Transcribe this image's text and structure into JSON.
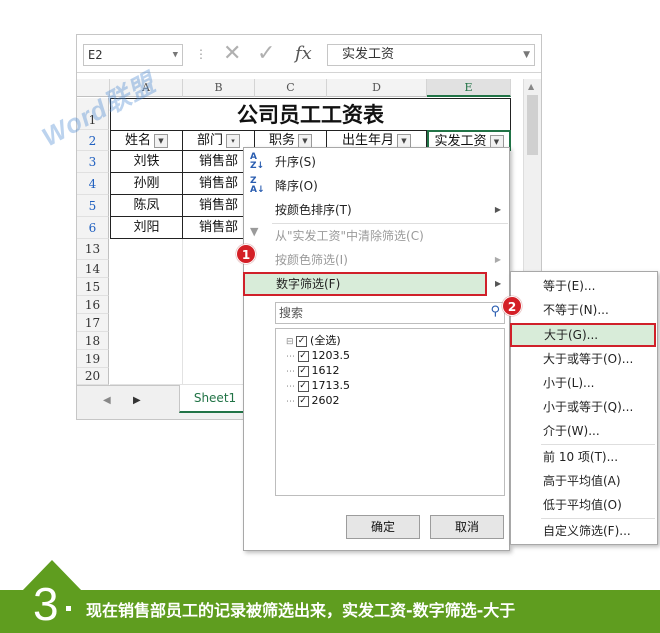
{
  "formula_bar": {
    "name_box": "E2",
    "formula": "实发工资"
  },
  "columns": [
    "A",
    "B",
    "C",
    "D",
    "E"
  ],
  "selected_column": "E",
  "rows": [
    {
      "num": "1",
      "cells": []
    },
    {
      "num": "2",
      "cells": [
        "姓名",
        "部门",
        "职务",
        "出生年月",
        "实发工资"
      ]
    },
    {
      "num": "3",
      "cells": [
        "刘铁",
        "销售部"
      ]
    },
    {
      "num": "4",
      "cells": [
        "孙刚",
        "销售部"
      ]
    },
    {
      "num": "5",
      "cells": [
        "陈凤",
        "销售部"
      ]
    },
    {
      "num": "6",
      "cells": [
        "刘阳",
        "销售部"
      ]
    },
    {
      "num": "13",
      "cells": []
    },
    {
      "num": "14",
      "cells": []
    },
    {
      "num": "15",
      "cells": []
    },
    {
      "num": "16",
      "cells": []
    },
    {
      "num": "17",
      "cells": []
    },
    {
      "num": "18",
      "cells": []
    },
    {
      "num": "19",
      "cells": []
    },
    {
      "num": "20",
      "cells": []
    }
  ],
  "table_title": "公司员工工资表",
  "sheet_tab": "Sheet1",
  "filter_menu": {
    "sort_asc": "升序(S)",
    "sort_desc": "降序(O)",
    "sort_by_color": "按颜色排序(T)",
    "clear_filter": "从\"实发工资\"中清除筛选(C)",
    "filter_by_color": "按颜色筛选(I)",
    "number_filters": "数字筛选(F)",
    "search_placeholder": "搜索",
    "items": [
      "(全选)",
      "1203.5",
      "1612",
      "1713.5",
      "2602"
    ],
    "ok": "确定",
    "cancel": "取消"
  },
  "submenu": {
    "items": [
      "等于(E)...",
      "不等于(N)...",
      "大于(G)...",
      "大于或等于(O)...",
      "小于(L)...",
      "小于或等于(Q)...",
      "介于(W)...",
      "前 10 项(T)...",
      "高于平均值(A)",
      "低于平均值(O)",
      "自定义筛选(F)..."
    ],
    "highlighted": "大于(G)..."
  },
  "badges": [
    "1",
    "2"
  ],
  "caption": {
    "step": "3",
    "text": "现在销售部员工的记录被筛选出来，实发工资-数字筛选-大于"
  },
  "watermark": "Word联盟",
  "colors": {
    "excel_green": "#217346",
    "highlight": "#d8ecd9",
    "badge_red": "#d41f26",
    "caption_green": "#5f9d1f"
  }
}
